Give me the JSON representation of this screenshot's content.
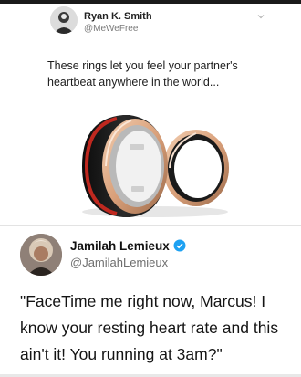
{
  "tweet_top": {
    "author_name": "Ryan K. Smith",
    "author_handle": "@MeWeFree",
    "text": "These rings let you feel your partner's heartbeat anywhere in the world..."
  },
  "tweet_bottom": {
    "author_name": "Jamilah Lemieux",
    "author_handle": "@JamilahLemieux",
    "verified": true,
    "text": "\"FaceTime me right now, Marcus! I know your resting heart rate and this ain't it! You running at 3am?\""
  },
  "colors": {
    "verified_blue": "#1da1f2",
    "ring_red": "#c0281f",
    "ring_gold": "#d9a07a"
  },
  "icons": [
    "avatar-ryan",
    "chevron-down-icon",
    "avatar-jamilah",
    "verified-badge-icon"
  ]
}
